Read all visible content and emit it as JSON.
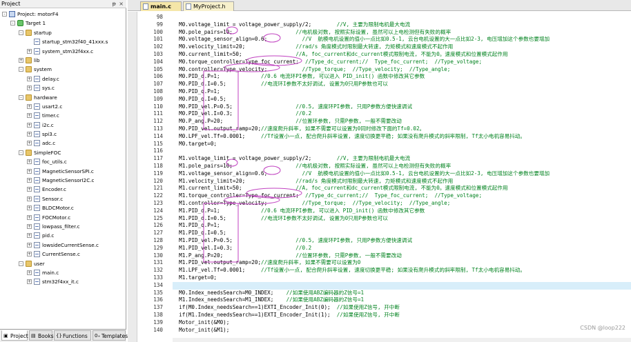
{
  "panel": {
    "title": "Project",
    "pin_glyph": "ᵽ",
    "close_glyph": "×"
  },
  "tree": [
    {
      "label": "Project: motorF4",
      "level": 0,
      "kind": "project",
      "exp": "-"
    },
    {
      "label": "Target 1",
      "level": 1,
      "kind": "target",
      "exp": "-"
    },
    {
      "label": "startup",
      "level": 2,
      "kind": "folder",
      "exp": "-"
    },
    {
      "label": "startup_stm32f40_41xxx.s",
      "level": 3,
      "kind": "file",
      "exp": ""
    },
    {
      "label": "system_stm32f4xx.c",
      "level": 3,
      "kind": "file",
      "exp": "+"
    },
    {
      "label": "lib",
      "level": 2,
      "kind": "folder",
      "exp": "+"
    },
    {
      "label": "system",
      "level": 2,
      "kind": "folder",
      "exp": "-"
    },
    {
      "label": "delay.c",
      "level": 3,
      "kind": "file",
      "exp": "+"
    },
    {
      "label": "sys.c",
      "level": 3,
      "kind": "file",
      "exp": "+"
    },
    {
      "label": "hardware",
      "level": 2,
      "kind": "folder",
      "exp": "-"
    },
    {
      "label": "usart2.c",
      "level": 3,
      "kind": "file",
      "exp": "+"
    },
    {
      "label": "timer.c",
      "level": 3,
      "kind": "file",
      "exp": "+"
    },
    {
      "label": "i2c.c",
      "level": 3,
      "kind": "file",
      "exp": "+"
    },
    {
      "label": "spi3.c",
      "level": 3,
      "kind": "file",
      "exp": "+"
    },
    {
      "label": "adc.c",
      "level": 3,
      "kind": "file",
      "exp": "+"
    },
    {
      "label": "SimpleFOC",
      "level": 2,
      "kind": "folder",
      "exp": "-"
    },
    {
      "label": "foc_utils.c",
      "level": 3,
      "kind": "file",
      "exp": "+"
    },
    {
      "label": "MagneticSensorSPI.c",
      "level": 3,
      "kind": "file",
      "exp": "+"
    },
    {
      "label": "MagneticSensorI2C.c",
      "level": 3,
      "kind": "file",
      "exp": "+"
    },
    {
      "label": "Encoder.c",
      "level": 3,
      "kind": "file",
      "exp": "+"
    },
    {
      "label": "Sensor.c",
      "level": 3,
      "kind": "file",
      "exp": "+"
    },
    {
      "label": "BLDCMotor.c",
      "level": 3,
      "kind": "file",
      "exp": "+"
    },
    {
      "label": "FOCMotor.c",
      "level": 3,
      "kind": "file",
      "exp": "+"
    },
    {
      "label": "lowpass_filter.c",
      "level": 3,
      "kind": "file",
      "exp": "+"
    },
    {
      "label": "pid.c",
      "level": 3,
      "kind": "file",
      "exp": "+"
    },
    {
      "label": "lowsideCurrentSense.c",
      "level": 3,
      "kind": "file",
      "exp": "+"
    },
    {
      "label": "CurrentSense.c",
      "level": 3,
      "kind": "file",
      "exp": "+"
    },
    {
      "label": "user",
      "level": 2,
      "kind": "folder",
      "exp": "-"
    },
    {
      "label": "main.c",
      "level": 3,
      "kind": "file",
      "exp": "+"
    },
    {
      "label": "stm32f4xx_it.c",
      "level": 3,
      "kind": "file",
      "exp": "+"
    }
  ],
  "panel_tabs": [
    {
      "label": "Project",
      "glyph": "▣",
      "active": true
    },
    {
      "label": "Books",
      "glyph": "▤",
      "active": false
    },
    {
      "label": "Functions",
      "glyph": "{}",
      "active": false
    },
    {
      "label": "Templates",
      "glyph": "0₊",
      "active": false
    }
  ],
  "editor_tabs": [
    {
      "label": "main.c",
      "active": true
    },
    {
      "label": "MyProject.h",
      "active": false
    }
  ],
  "code_lines": [
    {
      "n": "98",
      "code": "",
      "comment": ""
    },
    {
      "n": "99",
      "code": "  M0.voltage_limit = voltage_power_supply/2;",
      "comment": "        //V, 主要为限制电机最大电流"
    },
    {
      "n": "100",
      "code": "  M0.pole_pairs=10;",
      "comment": "                    //电机极对数, 按照实际设置, 虽然可以上电检测但有失败的概率"
    },
    {
      "n": "101",
      "code": "  M0.voltage_sensor_align=0.6;",
      "comment": "           //V  航模电机设置的值小一点比如0.5-1, 云台电机设置的大一点比如2-3, 电压增加这个参数也要增加"
    },
    {
      "n": "102",
      "code": "  M0.velocity_limit=20;",
      "comment": "                //rad/s 角度模式时限制最大转速, 力矩模式和速度模式不起作用"
    },
    {
      "n": "103",
      "code": "  M0.current_limit=50;",
      "comment": "                 //A, foc_current和dc_current模式限制电流, 不能为0。速度模式和位置模式起作用"
    },
    {
      "n": "104",
      "code": "  M0.torque_controller=Type_foc_current;",
      "comment": "  //Type_dc_current;//  Type_foc_current;  //Type_voltage;"
    },
    {
      "n": "105",
      "code": "  M0.controller=Type_velocity;",
      "comment": "           //Type_torque;  //Type_velocity;  //Type_angle;"
    },
    {
      "n": "106",
      "code": "  M0.PID_d.P=1;",
      "comment": "             //0.6 电流环PI参数, 可以进入 PID_init() 函数中修改其它参数"
    },
    {
      "n": "107",
      "code": "  M0.PID_d.I=0.5;",
      "comment": "           //电流环I参数不太好调试, 设置为0只用P参数也可以"
    },
    {
      "n": "108",
      "code": "  M0.PID_q.P=1;",
      "comment": ""
    },
    {
      "n": "109",
      "code": "  M0.PID_q.I=0.5;",
      "comment": ""
    },
    {
      "n": "110",
      "code": "  M0.PID_vel.P=0.5;",
      "comment": "                    //0.5, 速度环PI参数, 只用P参数方便快速调试"
    },
    {
      "n": "111",
      "code": "  M0.PID_vel.I=0.3;",
      "comment": "                    //0.2"
    },
    {
      "n": "112",
      "code": "  M0.P_ang.P=20;",
      "comment": "                       //位置环参数, 只需P参数, 一般不需要改动"
    },
    {
      "n": "113",
      "code": "  M0.PID_vel.output_ramp=20;",
      "comment": "//速度爬升斜率, 如果不需要可以设置为0同时修改下面的Tf=0.02。"
    },
    {
      "n": "114",
      "code": "  M0.LPF_vel.Tf=0.0001;",
      "comment": "     //Tf设置小一点, 配合爬升斜率设置, 速度切换更平稳; 如果没有爬升模式的斜率限制, Tf太小电机容易抖动。"
    },
    {
      "n": "115",
      "code": "  M0.target=0;",
      "comment": ""
    },
    {
      "n": "116",
      "code": "",
      "comment": ""
    },
    {
      "n": "117",
      "code": "  M1.voltage_limit = voltage_power_supply/2;",
      "comment": "        //V, 主要为限制电机最大电流"
    },
    {
      "n": "118",
      "code": "  M1.pole_pairs=10;",
      "comment": "                    //电机极对数, 按照实际设置, 虽然可以上电检测但有失败的概率"
    },
    {
      "n": "119",
      "code": "  M1.voltage_sensor_align=0.6;",
      "comment": "           //V  航模电机设置的值小一点比如0.5-1, 云台电机设置的大一点比如2-3, 电压增加这个参数也要增加"
    },
    {
      "n": "120",
      "code": "  M1.velocity_limit=20;",
      "comment": "                //rad/s 角度模式时限制最大转速, 力矩模式和速度模式不起作用"
    },
    {
      "n": "121",
      "code": "  M1.current_limit=50;",
      "comment": "                 //A, foc_current和dc_current模式限制电流, 不能为0。速度模式和位置模式起作用"
    },
    {
      "n": "122",
      "code": "  M1.torque_controller=Type_foc_current;",
      "comment": "  //Type_dc_current;//  Type_foc_current;  //Type_voltage;"
    },
    {
      "n": "123",
      "code": "  M1.controller=Type_velocity;",
      "comment": "           //Type_torque;  //Type_velocity;  //Type_angle;"
    },
    {
      "n": "124",
      "code": "  M1.PID_d.P=1;",
      "comment": "             //0.6 电流环PI参数, 可以进入 PID_init() 函数中修改其它参数"
    },
    {
      "n": "125",
      "code": "  M1.PID_d.I=0.5;",
      "comment": "           //电流环I参数不太好调试, 设置为0只用P参数也可以"
    },
    {
      "n": "126",
      "code": "  M1.PID_q.P=1;",
      "comment": ""
    },
    {
      "n": "127",
      "code": "  M1.PID_q.I=0.5;",
      "comment": ""
    },
    {
      "n": "128",
      "code": "  M1.PID_vel.P=0.5;",
      "comment": "                    //0.5, 速度环PI参数, 只用P参数方便快速调试"
    },
    {
      "n": "129",
      "code": "  M1.PID_vel.I=0.3;",
      "comment": "                    //0.2"
    },
    {
      "n": "130",
      "code": "  M1.P_ang.P=20;",
      "comment": "                       //位置环参数, 只需P参数, 一般不需要改动"
    },
    {
      "n": "131",
      "code": "  M1.PID_vel.output_ramp=20;",
      "comment": "//速度爬升斜率, 如果不需要可以设置为0"
    },
    {
      "n": "132",
      "code": "  M1.LPF_vel.Tf=0.0001;",
      "comment": "     //Tf设置小一点, 配合爬升斜率设置, 速度切换更平稳; 如果没有爬升模式的斜率限制, Tf太小电机容易抖动。"
    },
    {
      "n": "133",
      "code": "  M1.target=0;",
      "comment": ""
    },
    {
      "n": "134",
      "code": "",
      "comment": ""
    },
    {
      "n": "135",
      "code": "  M0.Index_needsSearch=M0_INDEX;",
      "comment": "    //如果使用ABZ编码器的Z信号=1"
    },
    {
      "n": "136",
      "code": "  M1.Index_needsSearch=M1_INDEX;",
      "comment": "    //如果使用ABZ编码器的Z信号=1"
    },
    {
      "n": "137",
      "code": "  if(M0.Index_needsSearch==1)EXTI_Encoder_Init(0);",
      "comment": "  //如果使用Z信号, 开中断"
    },
    {
      "n": "138",
      "code": "  if(M1.Index_needsSearch==1)EXTI_Encoder_Init(1);",
      "comment": "  //如果使用Z信号, 开中断"
    },
    {
      "n": "139",
      "code": "  Motor_init(&M0);",
      "comment": ""
    },
    {
      "n": "140",
      "code": "  Motor_init(&M1);",
      "comment": ""
    }
  ],
  "current_line": "134",
  "watermark": "CSDN @loop222",
  "colors": {
    "comment": "#00821e",
    "keyword": "#1a1aff",
    "annotation": "#c040c0",
    "current_line": "#d8eefa",
    "tab_active": "#f5e6a8",
    "folder": "#e8c66a"
  }
}
